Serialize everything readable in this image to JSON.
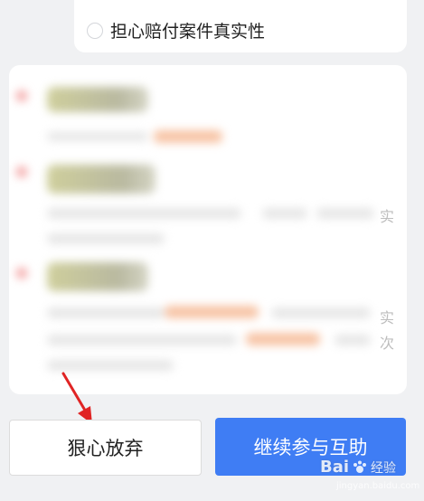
{
  "option": {
    "label": "担心赔付案件真实性",
    "selected": false
  },
  "blurred_content": {
    "edge_chars": [
      "实",
      "实",
      "次"
    ]
  },
  "buttons": {
    "give_up": "狠心放弃",
    "continue": "继续参与互助"
  },
  "annotation": {
    "arrow_color": "#e02424"
  },
  "watermark": {
    "brand": "Bai",
    "brand_suffix": "经验",
    "url": "jingyan.baidu.com"
  },
  "colors": {
    "primary": "#3f7df4",
    "background": "#f0f1f3"
  }
}
